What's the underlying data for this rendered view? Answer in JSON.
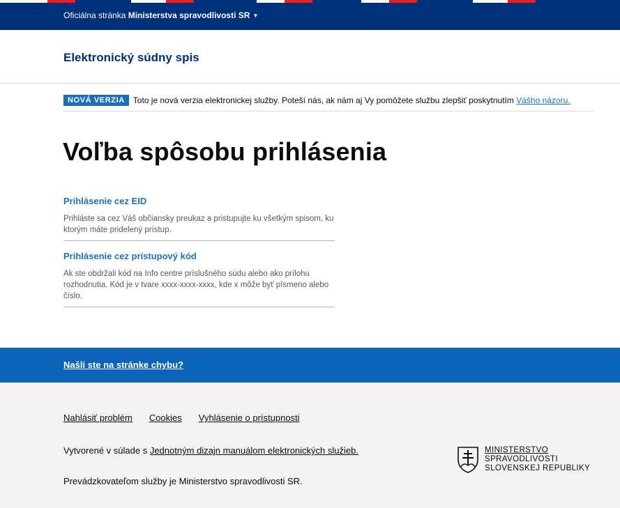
{
  "gov_banner": {
    "prefix": "Oficiálna stránka",
    "ministry": "Ministerstva spravodlivosti SR",
    "bg_color": "#003078"
  },
  "header": {
    "service_name": "Elektronický súdny spis"
  },
  "phase_banner": {
    "tag": "NOVÁ VERZIA",
    "text": "Toto je nová verzia elektronickej služby. Poteší nás, ak nám aj Vy pomôžete službu zlepšiť poskytnutím",
    "link": "Vášho názoru.",
    "tag_color": "#1d70b8"
  },
  "main": {
    "title": "Voľba spôsobu prihlásenia",
    "options": [
      {
        "label": "Prihlásenie cez EID",
        "description": "Prihláste sa cez Váš občiansky preukaz a pristupujte ku všetkým spisom, ku ktorým máte pridelený prístup."
      },
      {
        "label": "Prihlásenie cez prístupový kód",
        "description": "Ak ste obdržali kód na Info centre príslušného súdu alebo ako prílohu rozhodnutia. Kód je v tvare xxxx-xxxx-xxxx, kde x môže byť písmeno alebo číslo."
      }
    ]
  },
  "feedback": {
    "link": "Našli ste na stránke chybu?",
    "bg_color": "#0b64b8"
  },
  "footer": {
    "links": [
      "Nahlásiť problém",
      "Cookies",
      "Vyhlásenie o prístupnosti"
    ],
    "design_prefix": "Vytvorené v súlade s",
    "design_link": "Jednotným dizajn manuálom elektronických služieb.",
    "operator": "Prevádzkovateľom služby je Ministerstvo spravodlivosti SR.",
    "logo": {
      "line1": "MINISTERSTVO",
      "line2": "SPRAVODLIVOSTI",
      "line3": "SLOVENSKEJ REPUBLIKY"
    },
    "bg_color": "#f3f2f1"
  }
}
